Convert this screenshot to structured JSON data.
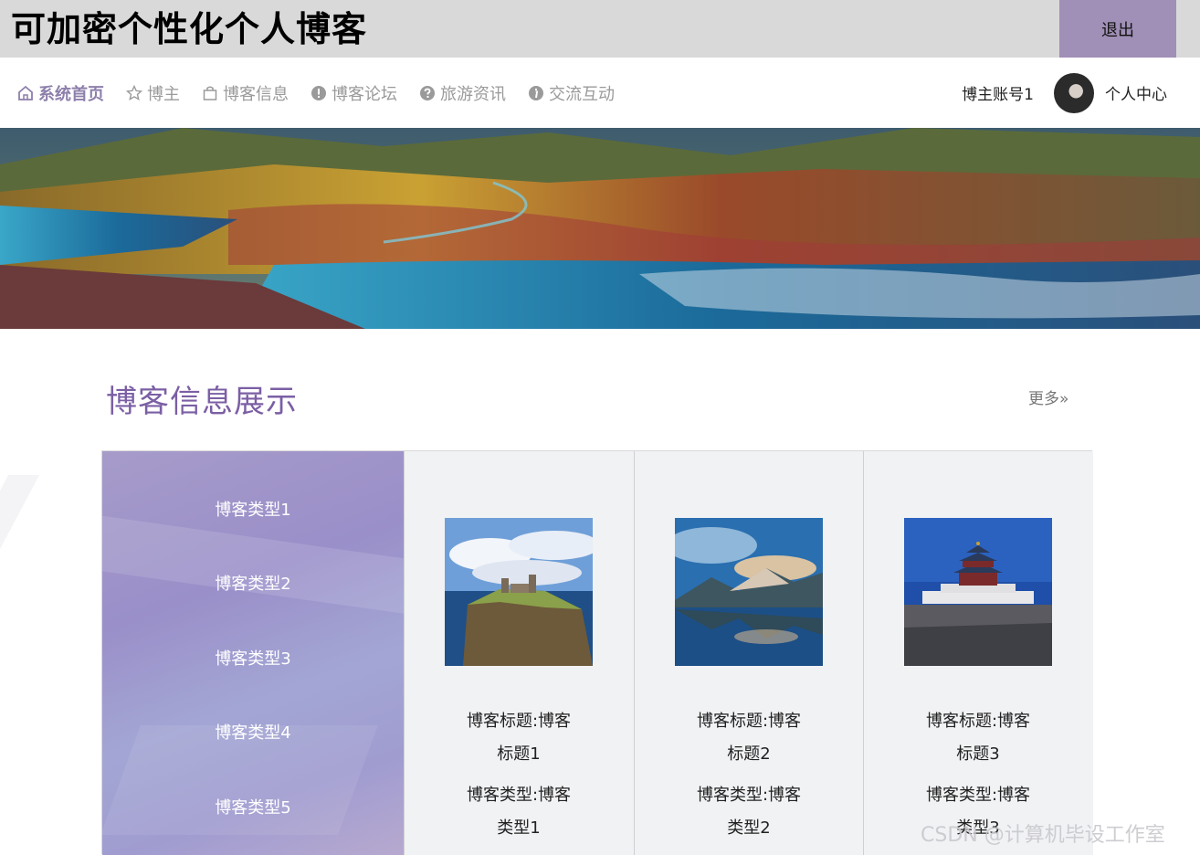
{
  "header": {
    "site_title": "可加密个性化个人博客",
    "logout_label": "退出"
  },
  "nav": {
    "items": [
      {
        "label": "系统首页",
        "icon": "home-icon",
        "active": true
      },
      {
        "label": "博主",
        "icon": "star-icon",
        "active": false
      },
      {
        "label": "博客信息",
        "icon": "bag-icon",
        "active": false
      },
      {
        "label": "博客论坛",
        "icon": "exclamation-circle-icon",
        "active": false
      },
      {
        "label": "旅游资讯",
        "icon": "question-circle-icon",
        "active": false
      },
      {
        "label": "交流互动",
        "icon": "info-circle-icon",
        "active": false
      }
    ],
    "account": "博主账号1",
    "personal_center": "个人中心"
  },
  "section": {
    "title": "博客信息展示",
    "more_label": "更多»"
  },
  "blog_types": [
    "博客类型1",
    "博客类型2",
    "博客类型3",
    "博客类型4",
    "博客类型5"
  ],
  "cards": [
    {
      "title_line1": "博客标题:博客",
      "title_line2": "标题1",
      "type_line1": "博客类型:博客",
      "type_line2": "类型1"
    },
    {
      "title_line1": "博客标题:博客",
      "title_line2": "标题2",
      "type_line1": "博客类型:博客",
      "type_line2": "类型2"
    },
    {
      "title_line1": "博客标题:博客",
      "title_line2": "标题3",
      "type_line1": "博客类型:博客",
      "type_line2": "类型3"
    }
  ],
  "watermark": "CSDN @计算机毕设工作室",
  "colors": {
    "accent": "#8d7fab",
    "logout_bg": "#a08fb6",
    "section_title": "#7b5fa4",
    "topbar_bg": "#d9d9d9"
  }
}
